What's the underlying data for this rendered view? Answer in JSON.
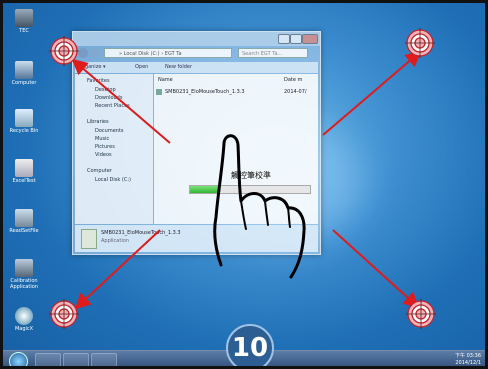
{
  "desktop": {
    "icons": [
      {
        "label": "TEC"
      },
      {
        "label": "Computer"
      },
      {
        "label": "Recycle Bin"
      },
      {
        "label": "ExcelTest"
      },
      {
        "label": "ReadSetFile"
      },
      {
        "label": "Calibration Application"
      },
      {
        "label": "MagicX"
      }
    ]
  },
  "explorer": {
    "address": "» Local Disk (C:) › EGT Ta",
    "search_placeholder": "Search EGT Ta...",
    "toolbar": {
      "organize": "Organize ▾",
      "open": "Open",
      "new_folder": "New folder"
    },
    "nav": {
      "favorites": "Favorites",
      "desktop": "Desktop",
      "downloads": "Downloads",
      "recent": "Recent Places",
      "libraries": "Libraries",
      "documents": "Documents",
      "music": "Music",
      "pictures": "Pictures",
      "videos": "Videos",
      "computer": "Computer",
      "local_disk": "Local Disk (C:)"
    },
    "columns": {
      "name": "Name",
      "date": "Date m"
    },
    "files": [
      {
        "name": "SMB0231_EloMouseTouch_1.3.3",
        "date": "2014-07/"
      }
    ],
    "details": {
      "name": "SMB0231_EloMouseTouch_1.3.3",
      "type": "Application"
    }
  },
  "calibration": {
    "progress_label": "觸控筆校準",
    "progress": 0.25,
    "countdown": "10"
  },
  "taskbar": {
    "time": "下午 03:36",
    "date": "2014/12/1"
  },
  "colors": {
    "arrow": "#e01b1b",
    "target_ring": "#c0242e",
    "count_bg": "#2d5e93"
  }
}
